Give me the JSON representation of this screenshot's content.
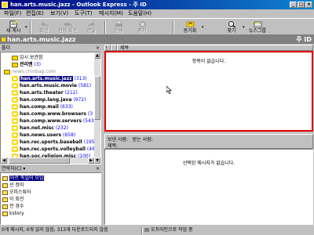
{
  "window": {
    "title": "han.arts.music.jazz - Outlook Express - 주 ID",
    "btn_min": "_",
    "btn_max": "□",
    "btn_close": "×"
  },
  "menu": [
    "파일(F)",
    "편집(E)",
    "보기(V)",
    "도구(T)",
    "메시지(M)",
    "도움말(H)"
  ],
  "toolbar": {
    "items": [
      {
        "label": "새 게시",
        "icon": "new-post-icon",
        "enabled": true
      },
      {
        "label": "회신",
        "icon": "reply-icon",
        "enabled": false
      },
      {
        "label": "전체 회신",
        "icon": "reply-all-icon",
        "enabled": false
      },
      {
        "label": "전달",
        "icon": "forward-icon",
        "enabled": false
      },
      {
        "label": "인쇄",
        "icon": "print-icon",
        "enabled": false
      },
      {
        "label": "중지",
        "icon": "stop-icon",
        "enabled": false
      },
      {
        "label": "동기화",
        "icon": "sync-icon",
        "enabled": true
      },
      {
        "label": "찾기",
        "icon": "find-icon",
        "enabled": true
      },
      {
        "label": "뉴스그룹",
        "icon": "newsgroups-icon",
        "enabled": true
      }
    ]
  },
  "folder_strip": {
    "name": "han.arts.music.jazz",
    "identity": "주 ID"
  },
  "folders_pane": {
    "title": "폴더",
    "close": "×",
    "items": [
      {
        "label": "임시 보관함",
        "count": "",
        "type": "folder",
        "indent": 1
      },
      {
        "label": "관리맨",
        "count": "(3)",
        "type": "folder",
        "indent": 1,
        "bold": true
      },
      {
        "label": "news.chinbag.com",
        "count": "",
        "type": "server",
        "indent": 0
      },
      {
        "label": "han.arts.music.jazz",
        "count": "(313)",
        "type": "news",
        "indent": 1,
        "selected": true,
        "bold": true
      },
      {
        "label": "han.arts.music.movie",
        "count": "(581)",
        "type": "news",
        "indent": 1,
        "bold": true
      },
      {
        "label": "han.arts.theater",
        "count": "(212)",
        "type": "news",
        "indent": 1,
        "bold": true
      },
      {
        "label": "han.comp.lang.java",
        "count": "(972)",
        "type": "news",
        "indent": 1,
        "bold": true
      },
      {
        "label": "han.comp.mail",
        "count": "(633)",
        "type": "news",
        "indent": 1,
        "bold": true
      },
      {
        "label": "han.comp.www.browsers",
        "count": "(3",
        "type": "news",
        "indent": 1,
        "bold": true
      },
      {
        "label": "han.comp.www.servers",
        "count": "(543",
        "type": "news",
        "indent": 1,
        "bold": true
      },
      {
        "label": "han.net.misc",
        "count": "(232)",
        "type": "news",
        "indent": 1,
        "bold": true
      },
      {
        "label": "han.news.users",
        "count": "(658)",
        "type": "news",
        "indent": 1,
        "bold": true
      },
      {
        "label": "han.rec.sports.baseball",
        "count": "(195)",
        "type": "news",
        "indent": 1,
        "bold": true
      },
      {
        "label": "han.rec.sports.volleyball",
        "count": "(46)",
        "type": "news",
        "indent": 1,
        "bold": true
      },
      {
        "label": "han.soc.religion.misc",
        "count": "(100)",
        "type": "news",
        "indent": 1,
        "bold": true
      },
      {
        "label": "han.test",
        "count": "(522)",
        "type": "news",
        "indent": 1,
        "bold": true
      }
    ]
  },
  "contacts_pane": {
    "title": "연락처(C)",
    "dropdown": "▾",
    "close": "×",
    "items": [
      {
        "label": "마르 독일어 모임",
        "selected": true
      },
      {
        "label": "선 정미",
        "selected": false
      },
      {
        "label": "오피스튜터",
        "selected": false
      },
      {
        "label": "이 회진",
        "selected": false
      },
      {
        "label": "전 경수",
        "selected": false
      },
      {
        "label": "kstory",
        "selected": false
      }
    ]
  },
  "message_list": {
    "column_subject": "제목",
    "empty_text": "항목이 없습니다.",
    "highlight_color": "#e00000"
  },
  "preview": {
    "from_label": "보낸 사람:",
    "to_label": "받는 사람:",
    "subject_label": "제목:",
    "empty_text": "선택된 메시지가 없습니다."
  },
  "status": {
    "main": "0개 메시지, 0개 읽지 않음, 313개 다운로드되지 않음",
    "work": "오프라인으로 작업 중"
  },
  "colors": {
    "title_start": "#000080",
    "title_end": "#1084d0",
    "selection": "#000080",
    "count": "#0000ff"
  }
}
